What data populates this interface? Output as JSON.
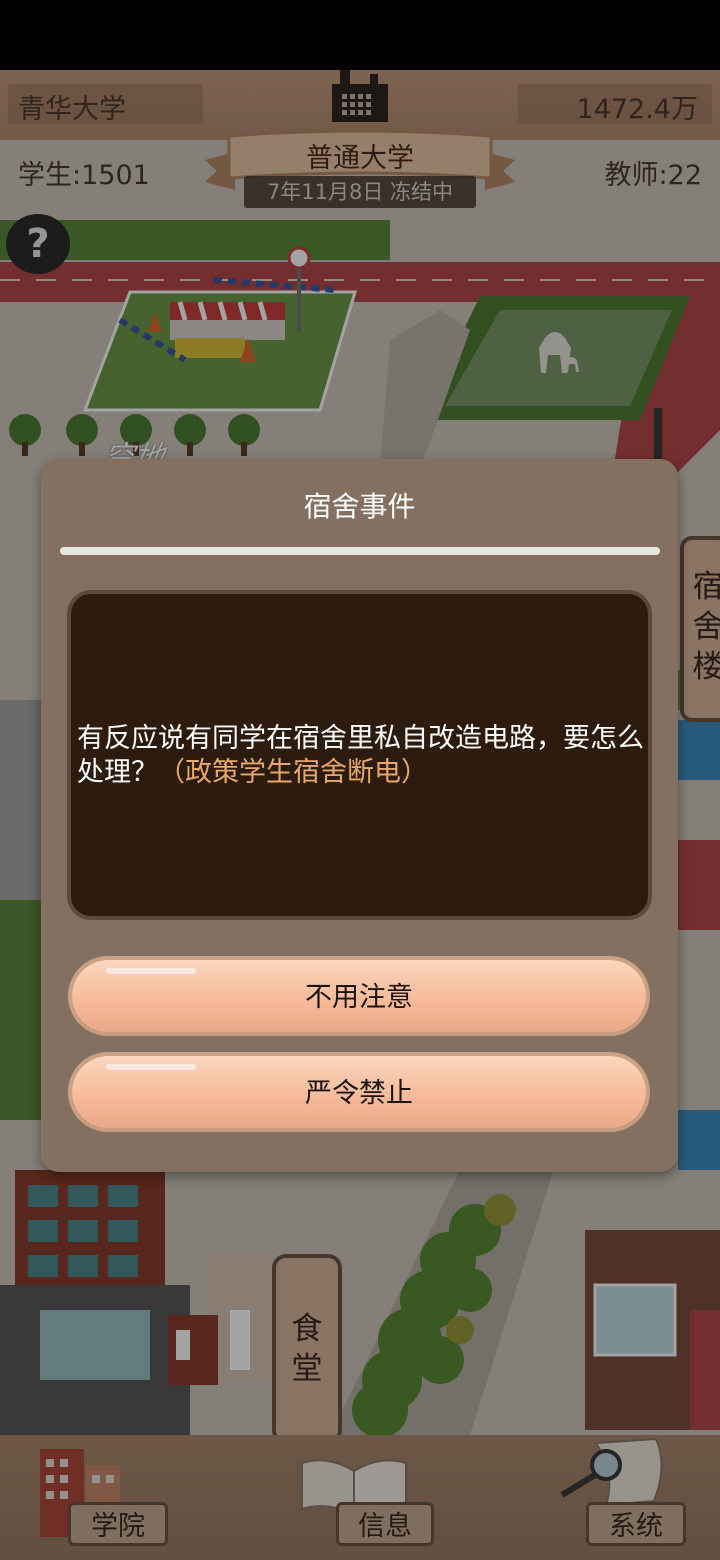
{
  "header": {
    "university_name": "青华大学",
    "funds": "1472.4万",
    "students": "学生:1501",
    "teachers": "教师:22",
    "school_level": "普通大学",
    "date_status": "7年11月8日 冻结中",
    "help_symbol": "?"
  },
  "map": {
    "empty_lot_label": "空地",
    "canteen_label_1": "食",
    "canteen_label_2": "堂",
    "dorm_label_1": "宿",
    "dorm_label_2": "舍",
    "dorm_label_3": "楼"
  },
  "dialog": {
    "title": "宿舍事件",
    "message": "有反应说有同学在宿舍里私自改造电路，要怎么处理？",
    "policy_note": "（政策学生宿舍断电）",
    "choices": [
      {
        "label": "不用注意"
      },
      {
        "label": "严令禁止"
      }
    ]
  },
  "bottom_nav": {
    "items": [
      {
        "label": "学院",
        "icon": "college-buildings-icon"
      },
      {
        "label": "信息",
        "icon": "open-book-icon"
      },
      {
        "label": "系统",
        "icon": "magnifier-scroll-icon"
      }
    ]
  },
  "colors": {
    "dialog_bg": "#837061",
    "message_bg": "#2d1b0e",
    "policy_text": "#e8a86a",
    "button_fill": "#f5b997"
  }
}
